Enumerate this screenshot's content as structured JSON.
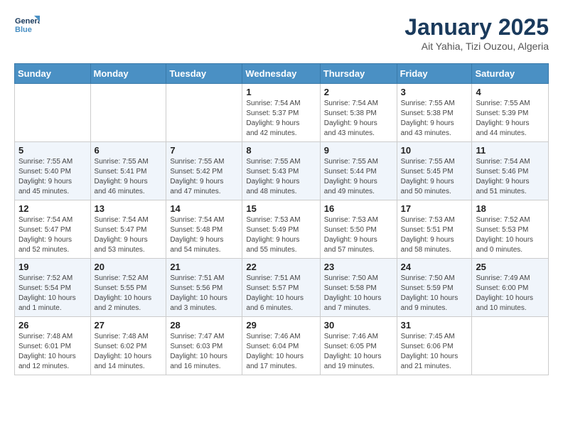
{
  "header": {
    "logo_line1": "General",
    "logo_line2": "Blue",
    "month_title": "January 2025",
    "subtitle": "Ait Yahia, Tizi Ouzou, Algeria"
  },
  "days_of_week": [
    "Sunday",
    "Monday",
    "Tuesday",
    "Wednesday",
    "Thursday",
    "Friday",
    "Saturday"
  ],
  "weeks": [
    [
      {
        "day": "",
        "info": ""
      },
      {
        "day": "",
        "info": ""
      },
      {
        "day": "",
        "info": ""
      },
      {
        "day": "1",
        "info": "Sunrise: 7:54 AM\nSunset: 5:37 PM\nDaylight: 9 hours\nand 42 minutes."
      },
      {
        "day": "2",
        "info": "Sunrise: 7:54 AM\nSunset: 5:38 PM\nDaylight: 9 hours\nand 43 minutes."
      },
      {
        "day": "3",
        "info": "Sunrise: 7:55 AM\nSunset: 5:38 PM\nDaylight: 9 hours\nand 43 minutes."
      },
      {
        "day": "4",
        "info": "Sunrise: 7:55 AM\nSunset: 5:39 PM\nDaylight: 9 hours\nand 44 minutes."
      }
    ],
    [
      {
        "day": "5",
        "info": "Sunrise: 7:55 AM\nSunset: 5:40 PM\nDaylight: 9 hours\nand 45 minutes."
      },
      {
        "day": "6",
        "info": "Sunrise: 7:55 AM\nSunset: 5:41 PM\nDaylight: 9 hours\nand 46 minutes."
      },
      {
        "day": "7",
        "info": "Sunrise: 7:55 AM\nSunset: 5:42 PM\nDaylight: 9 hours\nand 47 minutes."
      },
      {
        "day": "8",
        "info": "Sunrise: 7:55 AM\nSunset: 5:43 PM\nDaylight: 9 hours\nand 48 minutes."
      },
      {
        "day": "9",
        "info": "Sunrise: 7:55 AM\nSunset: 5:44 PM\nDaylight: 9 hours\nand 49 minutes."
      },
      {
        "day": "10",
        "info": "Sunrise: 7:55 AM\nSunset: 5:45 PM\nDaylight: 9 hours\nand 50 minutes."
      },
      {
        "day": "11",
        "info": "Sunrise: 7:54 AM\nSunset: 5:46 PM\nDaylight: 9 hours\nand 51 minutes."
      }
    ],
    [
      {
        "day": "12",
        "info": "Sunrise: 7:54 AM\nSunset: 5:47 PM\nDaylight: 9 hours\nand 52 minutes."
      },
      {
        "day": "13",
        "info": "Sunrise: 7:54 AM\nSunset: 5:47 PM\nDaylight: 9 hours\nand 53 minutes."
      },
      {
        "day": "14",
        "info": "Sunrise: 7:54 AM\nSunset: 5:48 PM\nDaylight: 9 hours\nand 54 minutes."
      },
      {
        "day": "15",
        "info": "Sunrise: 7:53 AM\nSunset: 5:49 PM\nDaylight: 9 hours\nand 55 minutes."
      },
      {
        "day": "16",
        "info": "Sunrise: 7:53 AM\nSunset: 5:50 PM\nDaylight: 9 hours\nand 57 minutes."
      },
      {
        "day": "17",
        "info": "Sunrise: 7:53 AM\nSunset: 5:51 PM\nDaylight: 9 hours\nand 58 minutes."
      },
      {
        "day": "18",
        "info": "Sunrise: 7:52 AM\nSunset: 5:53 PM\nDaylight: 10 hours\nand 0 minutes."
      }
    ],
    [
      {
        "day": "19",
        "info": "Sunrise: 7:52 AM\nSunset: 5:54 PM\nDaylight: 10 hours\nand 1 minute."
      },
      {
        "day": "20",
        "info": "Sunrise: 7:52 AM\nSunset: 5:55 PM\nDaylight: 10 hours\nand 2 minutes."
      },
      {
        "day": "21",
        "info": "Sunrise: 7:51 AM\nSunset: 5:56 PM\nDaylight: 10 hours\nand 3 minutes."
      },
      {
        "day": "22",
        "info": "Sunrise: 7:51 AM\nSunset: 5:57 PM\nDaylight: 10 hours\nand 6 minutes."
      },
      {
        "day": "23",
        "info": "Sunrise: 7:50 AM\nSunset: 5:58 PM\nDaylight: 10 hours\nand 7 minutes."
      },
      {
        "day": "24",
        "info": "Sunrise: 7:50 AM\nSunset: 5:59 PM\nDaylight: 10 hours\nand 9 minutes."
      },
      {
        "day": "25",
        "info": "Sunrise: 7:49 AM\nSunset: 6:00 PM\nDaylight: 10 hours\nand 10 minutes."
      }
    ],
    [
      {
        "day": "26",
        "info": "Sunrise: 7:48 AM\nSunset: 6:01 PM\nDaylight: 10 hours\nand 12 minutes."
      },
      {
        "day": "27",
        "info": "Sunrise: 7:48 AM\nSunset: 6:02 PM\nDaylight: 10 hours\nand 14 minutes."
      },
      {
        "day": "28",
        "info": "Sunrise: 7:47 AM\nSunset: 6:03 PM\nDaylight: 10 hours\nand 16 minutes."
      },
      {
        "day": "29",
        "info": "Sunrise: 7:46 AM\nSunset: 6:04 PM\nDaylight: 10 hours\nand 17 minutes."
      },
      {
        "day": "30",
        "info": "Sunrise: 7:46 AM\nSunset: 6:05 PM\nDaylight: 10 hours\nand 19 minutes."
      },
      {
        "day": "31",
        "info": "Sunrise: 7:45 AM\nSunset: 6:06 PM\nDaylight: 10 hours\nand 21 minutes."
      },
      {
        "day": "",
        "info": ""
      }
    ]
  ]
}
